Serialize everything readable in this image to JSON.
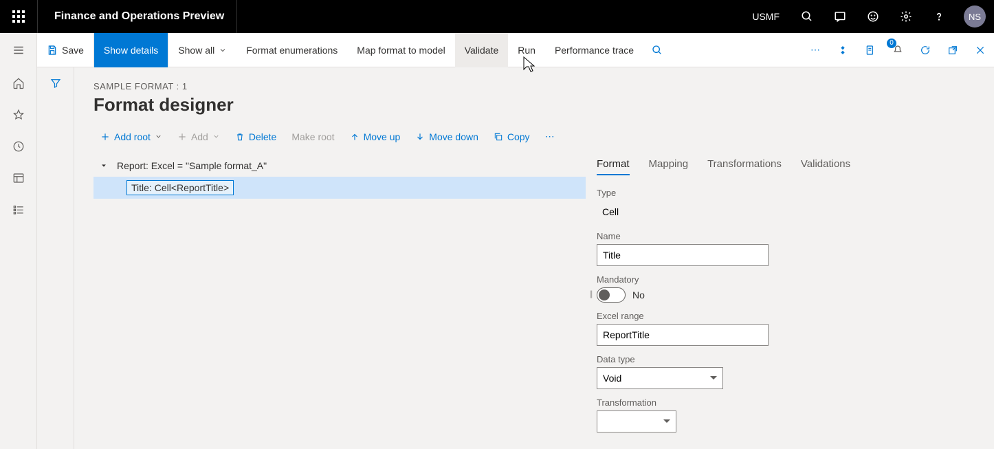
{
  "topbar": {
    "app_title": "Finance and Operations Preview",
    "environment": "USMF",
    "avatar_initials": "NS"
  },
  "actionbar": {
    "save": "Save",
    "show_details": "Show details",
    "show_all": "Show all",
    "format_enum": "Format enumerations",
    "map_format": "Map format to model",
    "validate": "Validate",
    "run": "Run",
    "perf_trace": "Performance trace",
    "badge_count": "0"
  },
  "breadcrumb": "SAMPLE FORMAT : 1",
  "page_title": "Format designer",
  "toolbar": {
    "add_root": "Add root",
    "add": "Add",
    "delete": "Delete",
    "make_root": "Make root",
    "move_up": "Move up",
    "move_down": "Move down",
    "copy": "Copy"
  },
  "tree": {
    "root": "Report: Excel = \"Sample format_A\"",
    "child": "Title: Cell<ReportTitle>"
  },
  "tabs": {
    "format": "Format",
    "mapping": "Mapping",
    "transformations": "Transformations",
    "validations": "Validations"
  },
  "form": {
    "type_label": "Type",
    "type_value": "Cell",
    "name_label": "Name",
    "name_value": "Title",
    "mandatory_label": "Mandatory",
    "mandatory_value": "No",
    "excel_range_label": "Excel range",
    "excel_range_value": "ReportTitle",
    "data_type_label": "Data type",
    "data_type_value": "Void",
    "transformation_label": "Transformation",
    "transformation_value": ""
  }
}
